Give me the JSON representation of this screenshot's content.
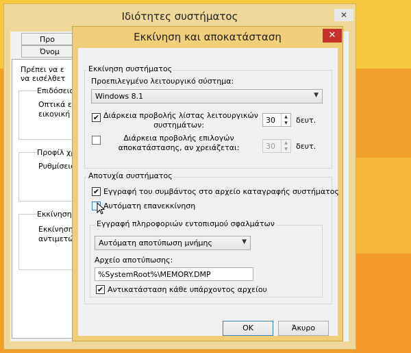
{
  "background_window": {
    "title": "Ιδιότητες συστήματος",
    "close_glyph": "✕",
    "tabs": [
      "Προ",
      "Όνομ"
    ],
    "texts": [
      "Πρέπει να ε",
      "να εισέλθετ",
      "Επιδόσεις",
      "Οπτικά εφ",
      "εικονική μ",
      "Προφίλ χρ",
      "Ρυθμίσεις",
      "Εκκίνηση κ",
      "Εκκίνηση",
      "αντιμετώ"
    ]
  },
  "dialog": {
    "title": "Εκκίνηση και αποκατάσταση",
    "close_glyph": "✕",
    "startup": {
      "legend": "Εκκίνηση συστήματος",
      "default_os_label": "Προεπιλεγμένο λειτουργικό σύστημα:",
      "default_os_value": "Windows 8.1",
      "show_list_label_1": "Διάρκεια προβολής λίστας λειτουργικών",
      "show_list_label_2": "συστημάτων:",
      "show_list_value": "30",
      "show_recovery_label_1": "Διάρκεια προβολής επιλογών",
      "show_recovery_label_2": "αποκατάστασης, αν χρειάζεται:",
      "show_recovery_value": "30",
      "unit": "δευτ."
    },
    "failure": {
      "legend": "Αποτυχία συστήματος",
      "write_event_label": "Εγγραφή του συμβάντος στο αρχείο καταγραφής συστήματος",
      "auto_restart_label": "Αυτόματη επανεκκίνηση",
      "debug_legend": "Εγγραφή πληροφοριών εντοπισμού σφαλμάτων",
      "dump_type_value": "Αυτόματη αποτύπωση μνήμης",
      "dump_file_label": "Αρχείο αποτύπωσης:",
      "dump_file_value": "%SystemRoot%\\MEMORY.DMP",
      "overwrite_label": "Αντικατάσταση κάθε υπάρχοντος αρχείου"
    },
    "buttons": {
      "ok": "OK",
      "cancel": "Άκυρο"
    },
    "check_glyph": "✔",
    "arrow_down": "▼",
    "arrow_up_small": "▲",
    "arrow_down_small": "▼"
  },
  "colors": {
    "accent_close": "#c7312b",
    "window_frame": "#f1cf7a"
  }
}
